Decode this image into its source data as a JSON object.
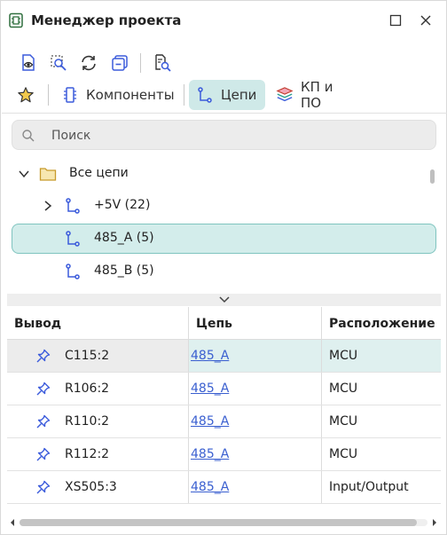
{
  "window": {
    "title": "Менеджер проекта"
  },
  "toolbar": {
    "icons": [
      "preview-document-icon",
      "zoom-area-icon",
      "refresh-icon",
      "collapse-icon",
      "find-in-document-icon"
    ]
  },
  "tabs": [
    {
      "label": "",
      "icon": "star-icon",
      "active": false
    },
    {
      "label": "Компоненты",
      "icon": "component-icon",
      "active": false
    },
    {
      "label": "Цепи",
      "icon": "net-icon",
      "active": true
    },
    {
      "label": "КП и ПО",
      "icon": "layers-icon",
      "active": false
    }
  ],
  "search": {
    "placeholder": "Поиск",
    "value": ""
  },
  "tree": {
    "root": {
      "label": "Все цепи",
      "expanded": true
    },
    "items": [
      {
        "label": "+5V (22)",
        "expandable": true,
        "selected": false
      },
      {
        "label": "485_A (5)",
        "expandable": false,
        "selected": true
      },
      {
        "label": "485_B (5)",
        "expandable": false,
        "selected": false
      }
    ]
  },
  "table": {
    "headers": [
      "Вывод",
      "Цепь",
      "Расположение"
    ],
    "rows": [
      {
        "pin": "C115:2",
        "net": "485_A",
        "location": "MCU",
        "selected": true
      },
      {
        "pin": "R106:2",
        "net": "485_A",
        "location": "MCU",
        "selected": false
      },
      {
        "pin": "R110:2",
        "net": "485_A",
        "location": "MCU",
        "selected": false
      },
      {
        "pin": "R112:2",
        "net": "485_A",
        "location": "MCU",
        "selected": false
      },
      {
        "pin": "XS505:3",
        "net": "485_A",
        "location": "Input/Output",
        "selected": false
      }
    ]
  },
  "colors": {
    "accent": "#cfe9e8",
    "selected_border": "#7fc4bf",
    "link": "#3a5fd0",
    "icon_blue": "#3b5bdb"
  }
}
